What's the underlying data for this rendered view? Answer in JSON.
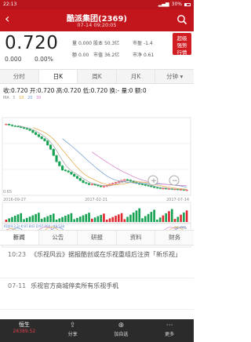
{
  "status": {
    "time": "22:13",
    "battery": "30%"
  },
  "header": {
    "title": "酷派集团(2369)",
    "subtitle": "07-14 09:20:05"
  },
  "quote": {
    "price": "0.720",
    "change": "0.000",
    "change_pct": "0.00%",
    "stats": [
      {
        "label": "量",
        "value": "0.000"
      },
      {
        "label": "股本",
        "value": "50.3亿"
      },
      {
        "label": "市盈",
        "value": "-1.4"
      },
      {
        "label": "额",
        "value": "0.00"
      },
      {
        "label": "市值",
        "value": "36.2亿"
      },
      {
        "label": "市净",
        "value": "0.61"
      }
    ],
    "promo": "超级\n强势\n行情"
  },
  "period_tabs": [
    "分时",
    "日K",
    "周K",
    "月K",
    "分钟 ▾"
  ],
  "active_period": 1,
  "info_line": "收:0.720 开:0.720 高:0.720 低:0.720 换:- 量:0 额:0",
  "ma_legend": [
    "MA",
    "5",
    "10",
    "20",
    "30"
  ],
  "chart_data": {
    "type": "candlestick",
    "x_start": "2016-09-27",
    "x_mid": "2017-02-21",
    "x_end": "2017-07-14",
    "ylim": [
      0.65,
      2.4
    ],
    "y_top_label": "",
    "y_bottom_label": "0.65",
    "close": [
      2.3,
      2.28,
      2.26,
      2.25,
      2.24,
      2.22,
      2.2,
      2.18,
      2.15,
      2.1,
      2.05,
      2.0,
      1.95,
      1.9,
      1.8,
      1.7,
      1.55,
      1.4,
      1.3,
      1.2,
      1.18,
      1.15,
      1.1,
      1.05,
      1.0,
      0.95,
      0.9,
      0.88,
      0.85,
      0.86,
      0.84,
      0.82,
      0.8,
      0.81,
      0.83,
      0.86,
      0.88,
      0.9,
      0.92,
      0.95,
      0.97,
      0.96,
      0.93,
      0.9,
      0.88,
      0.86,
      0.85,
      0.83,
      0.82,
      0.8,
      0.78,
      0.77,
      0.76,
      0.76,
      0.75,
      0.75,
      0.74,
      0.74,
      0.73,
      0.73,
      0.72,
      0.72
    ],
    "volume_ticks": [
      0,
      1,
      2
    ],
    "macd_labels": {
      "top": "96.465",
      "bottom": "-8.757"
    },
    "macd_legend": "KDJ(9,3,3) K:97.843 D:97.000 J:99.528"
  },
  "zoom": {
    "in_label": "+",
    "out_label": "−"
  },
  "news_tabs": [
    "新闻",
    "公告",
    "研报",
    "资料",
    "财务"
  ],
  "active_news_tab": 0,
  "news": [
    {
      "time": "10:23",
      "text": "《乐视风云》据报酷创或在乐视重组后注资「新乐视」"
    },
    {
      "time": "07-11",
      "text": "乐视官方商城停卖所有乐视手机"
    }
  ],
  "bottom_bar": {
    "index_name": "恒生",
    "index_value": "26389.52",
    "items": [
      {
        "icon": "share-icon",
        "glyph": "⇪",
        "label": "分享"
      },
      {
        "icon": "plus-icon",
        "glyph": "⊕",
        "label": "加自选"
      },
      {
        "icon": "more-icon",
        "glyph": "⋯",
        "label": "更多"
      }
    ]
  },
  "colors": {
    "brand": "#c3161c",
    "up": "#e02a32",
    "down": "#18a354",
    "ma5": "#9e9e9e",
    "ma10": "#e6a23c",
    "ma20": "#6c9bd2",
    "ma30": "#d47ac7"
  }
}
